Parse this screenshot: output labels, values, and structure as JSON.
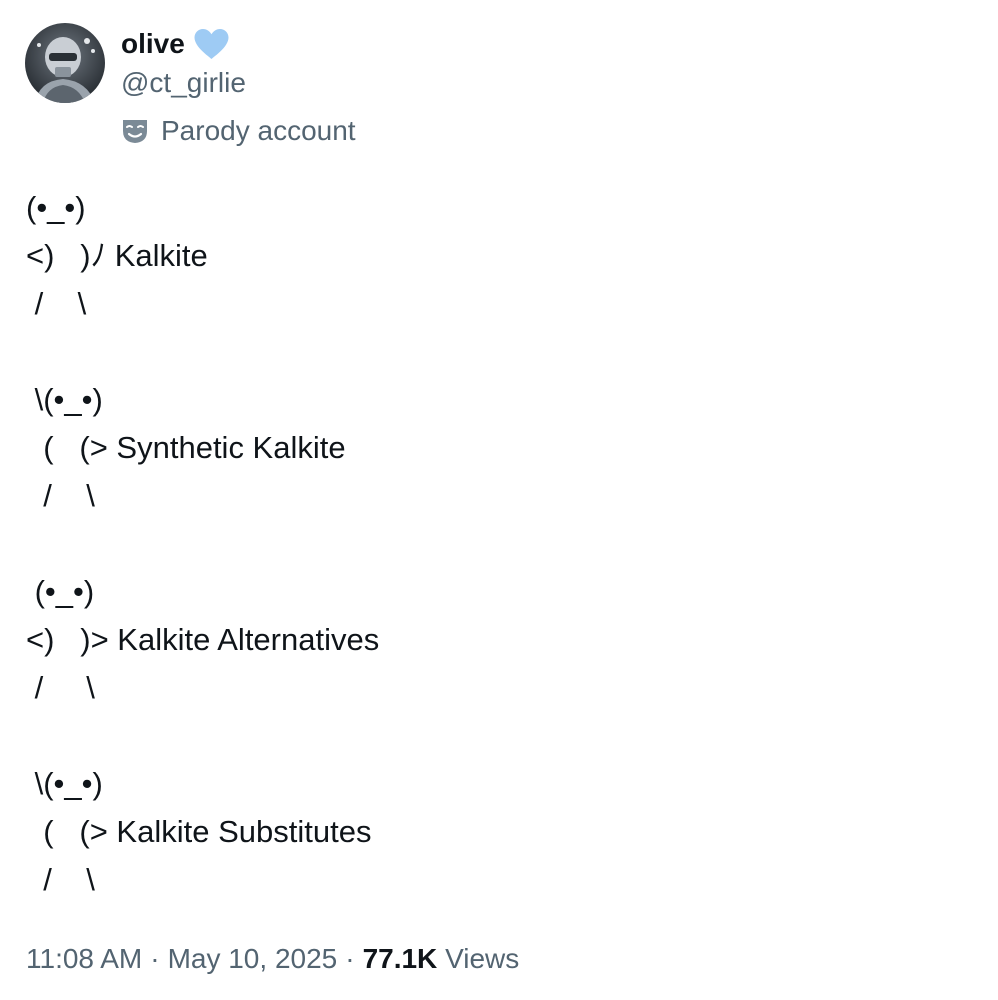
{
  "user": {
    "display_name": "olive",
    "handle": "@ct_girlie",
    "badge_icon": "blue-heart-icon",
    "badge_color": "#9ecbf4",
    "label": "Parody account",
    "label_icon": "theater-mask-icon"
  },
  "tweet": {
    "text": "(•_•)\n<)   )ﾉ Kalkite\n /    \\\n\n \\(•_•)\n  (   (> Synthetic Kalkite\n  /    \\\n\n (•_•)\n<)   )> Kalkite Alternatives\n /     \\\n\n \\(•_•)\n  (   (> Kalkite Substitutes\n  /    \\"
  },
  "meta": {
    "time": "11:08 AM",
    "separator": "·",
    "date": "May 10, 2025",
    "views_count": "77.1K",
    "views_label": "Views"
  },
  "colors": {
    "text_primary": "#0f1419",
    "text_secondary": "#536471"
  }
}
